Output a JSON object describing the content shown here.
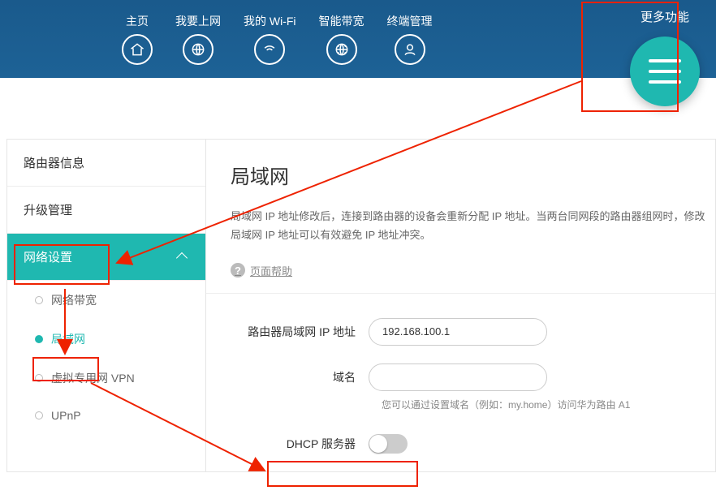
{
  "nav": {
    "items": [
      {
        "label": "主页"
      },
      {
        "label": "我要上网"
      },
      {
        "label": "我的 Wi-Fi"
      },
      {
        "label": "智能带宽"
      },
      {
        "label": "终端管理"
      }
    ],
    "more_label": "更多功能"
  },
  "sidebar": {
    "router_info": "路由器信息",
    "upgrade": "升级管理",
    "network_settings": "网络设置",
    "sub": {
      "wan": "网络带宽",
      "lan": "局域网",
      "vpn": "虚拟专用网 VPN",
      "upnp": "UPnP"
    }
  },
  "content": {
    "title": "局域网",
    "desc": "局域网 IP 地址修改后，连接到路由器的设备会重新分配 IP 地址。当两台同网段的路由器组网时，修改局域网 IP 地址可以有效避免 IP 地址冲突。",
    "help": "页面帮助",
    "ip_label": "路由器局域网 IP 地址",
    "ip_value": "192.168.100.1",
    "domain_label": "域名",
    "domain_value": "",
    "domain_hint": "您可以通过设置域名（例如：my.home）访问华为路由 A1",
    "dhcp_label": "DHCP 服务器"
  }
}
